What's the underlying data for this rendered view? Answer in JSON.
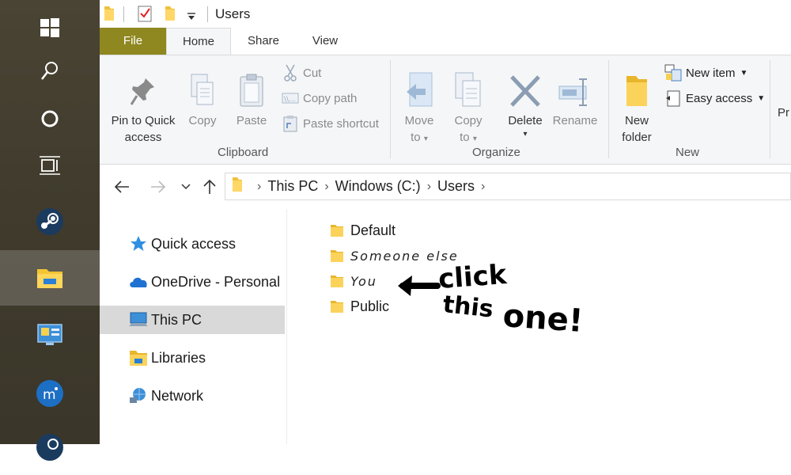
{
  "taskbar": {
    "items": [
      {
        "name": "windows-start-icon"
      },
      {
        "name": "search-icon"
      },
      {
        "name": "cortana-icon"
      },
      {
        "name": "task-view-icon"
      },
      {
        "name": "steam-icon"
      },
      {
        "name": "file-explorer-icon",
        "active": true
      },
      {
        "name": "control-panel-icon"
      },
      {
        "name": "musescore-icon"
      },
      {
        "name": "steam-icon-2"
      }
    ]
  },
  "window": {
    "title": "Users"
  },
  "ribbon_tabs": {
    "file": "File",
    "home": "Home",
    "share": "Share",
    "view": "View"
  },
  "ribbon": {
    "clipboard": {
      "label": "Clipboard",
      "pin_line1": "Pin to Quick",
      "pin_line2": "access",
      "copy": "Copy",
      "paste": "Paste",
      "cut": "Cut",
      "copy_path": "Copy path",
      "paste_shortcut": "Paste shortcut"
    },
    "organize": {
      "label": "Organize",
      "move_line1": "Move",
      "move_line2": "to",
      "copy_line1": "Copy",
      "copy_line2": "to",
      "delete": "Delete",
      "rename": "Rename"
    },
    "new": {
      "label": "New",
      "new_folder_line1": "New",
      "new_folder_line2": "folder",
      "new_item": "New item",
      "easy_access": "Easy access"
    },
    "partial": "Pr"
  },
  "address": {
    "crumbs": [
      "This PC",
      "Windows (C:)",
      "Users"
    ]
  },
  "nav": {
    "items": [
      {
        "label": "Quick access",
        "icon": "star-icon"
      },
      {
        "label": "OneDrive - Personal",
        "icon": "cloud-icon"
      },
      {
        "label": "This PC",
        "icon": "computer-icon",
        "selected": true
      },
      {
        "label": "Libraries",
        "icon": "library-icon"
      },
      {
        "label": "Network",
        "icon": "network-icon"
      }
    ]
  },
  "files": {
    "items": [
      {
        "label": "Default"
      },
      {
        "label": "Someone else",
        "handwritten": true
      },
      {
        "label": "You",
        "handwritten": true
      },
      {
        "label": "Public"
      }
    ]
  },
  "annotation": {
    "text_line1": "click",
    "text_line2": "this",
    "text_line3": "one!"
  }
}
